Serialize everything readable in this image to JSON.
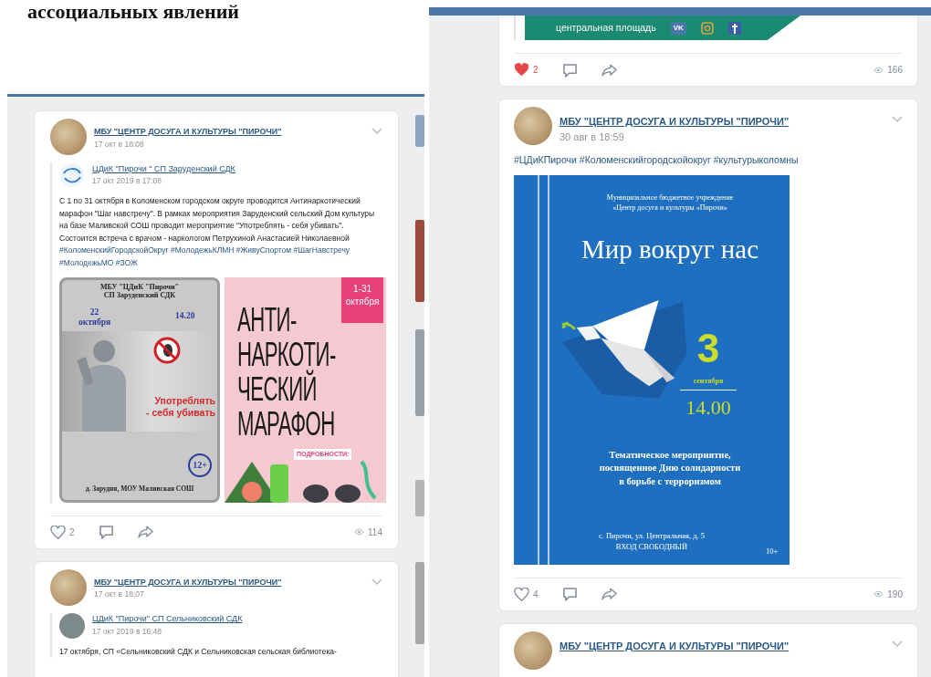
{
  "document": {
    "heading": "ассоциальных явлений"
  },
  "screenshots": [
    {
      "posts": [
        {
          "kind": "full",
          "author": "МБУ \"ЦЕНТР ДОСУГА И КУЛЬТУРЫ \"ПИРОЧИ\"",
          "date": "17 окт в 18:08",
          "repost": {
            "logo": true,
            "author": "ЦДиК \"Пирочи \" СП Заруденский СДК",
            "date": "17 окт 2019 в 17:08",
            "text": "С 1 по 31 октября в Коломенском городском округе проводится Антинаркотический марафон \"Шаг навстречу\". В рамках мероприятия Заруденский сельский Дом культуры на базе Маливской СОШ проводит мероприятие \"Употреблять - себя убивать\". Состоится встреча с врачом - наркологом Петрухиной Анастасией Николаевной",
            "hashtags": "#КоломенскийГородскойОкруг #МолодежьКЛМН #ЖивуСпортом #ШагНавстречу #МолодежьМО #ЗОЖ",
            "images": [
              {
                "kind": "photo-poster",
                "header": [
                  "МБУ \"ЦДиК \"Пирочи\"",
                  "СП Заруденский СДК"
                ],
                "date": [
                  "22",
                  "октября"
                ],
                "time": "14.20",
                "slogan": [
                  "Употреблять",
                  "- себя убивать"
                ],
                "age": "12+",
                "footer": "д. Зарудня, МОУ Маливская СОШ"
              },
              {
                "kind": "marathon-poster",
                "dates": [
                  "1-31",
                  "октября"
                ],
                "title": [
                  "АНТИ-",
                  "НАРКОТИ-",
                  "ЧЕСКИЙ",
                  "МАРАФОН"
                ],
                "details": "ПОДРОБНОСТИ:"
              }
            ]
          },
          "actions": {
            "likes": "2",
            "liked": false,
            "views": "114"
          }
        },
        {
          "kind": "full",
          "author": "МБУ \"ЦЕНТР ДОСУГА И КУЛЬТУРЫ \"ПИРОЧИ\"",
          "date": "17 окт в 18:07",
          "repost": {
            "logo": false,
            "author": "ЦДиК \"Пирочи\" СП Сельниковский СДК",
            "date": "17 окт 2019 в 16:48",
            "text": "17 октября, СП «Сельниковский СДК и Сельниковская сельская библиотека-"
          }
        }
      ]
    },
    {
      "posts": [
        {
          "kind": "tail",
          "banner": {
            "text": "центральная площадь",
            "badges": [
              "VK"
            ]
          },
          "actions": {
            "likes": "2",
            "liked": true,
            "views": "166"
          }
        },
        {
          "kind": "full",
          "author": "МБУ \"ЦЕНТР ДОСУГА И КУЛЬТУРЫ \"ПИРОЧИ\"",
          "date": "30 авг в 18:59",
          "hashtags": "#ЦДиКПирочи #Коломенскийгородскойокруг #культурыколомны",
          "images": [
            {
              "kind": "peace-poster",
              "header": [
                "Муниципальное бюджетное учреждение",
                "«Центр досуга и культуры «Пирочи»"
              ],
              "title": "Мир вокруг нас",
              "day": "3",
              "month": "сентября",
              "time": "14.00",
              "description": [
                "Тематическое мероприятие,",
                "посвященное Дню солидарности",
                "в борьбе с терроризмом"
              ],
              "address": [
                "с. Пирочи, ул. Центральная, д. 5",
                "ВХОД СВОБОДНЫЙ"
              ],
              "age": "10+"
            }
          ],
          "actions": {
            "likes": "4",
            "liked": false,
            "views": "190"
          }
        },
        {
          "kind": "full",
          "author": "МБУ \"ЦЕНТР ДОСУГА И КУЛЬТУРЫ \"ПИРОЧИ\""
        }
      ]
    }
  ]
}
